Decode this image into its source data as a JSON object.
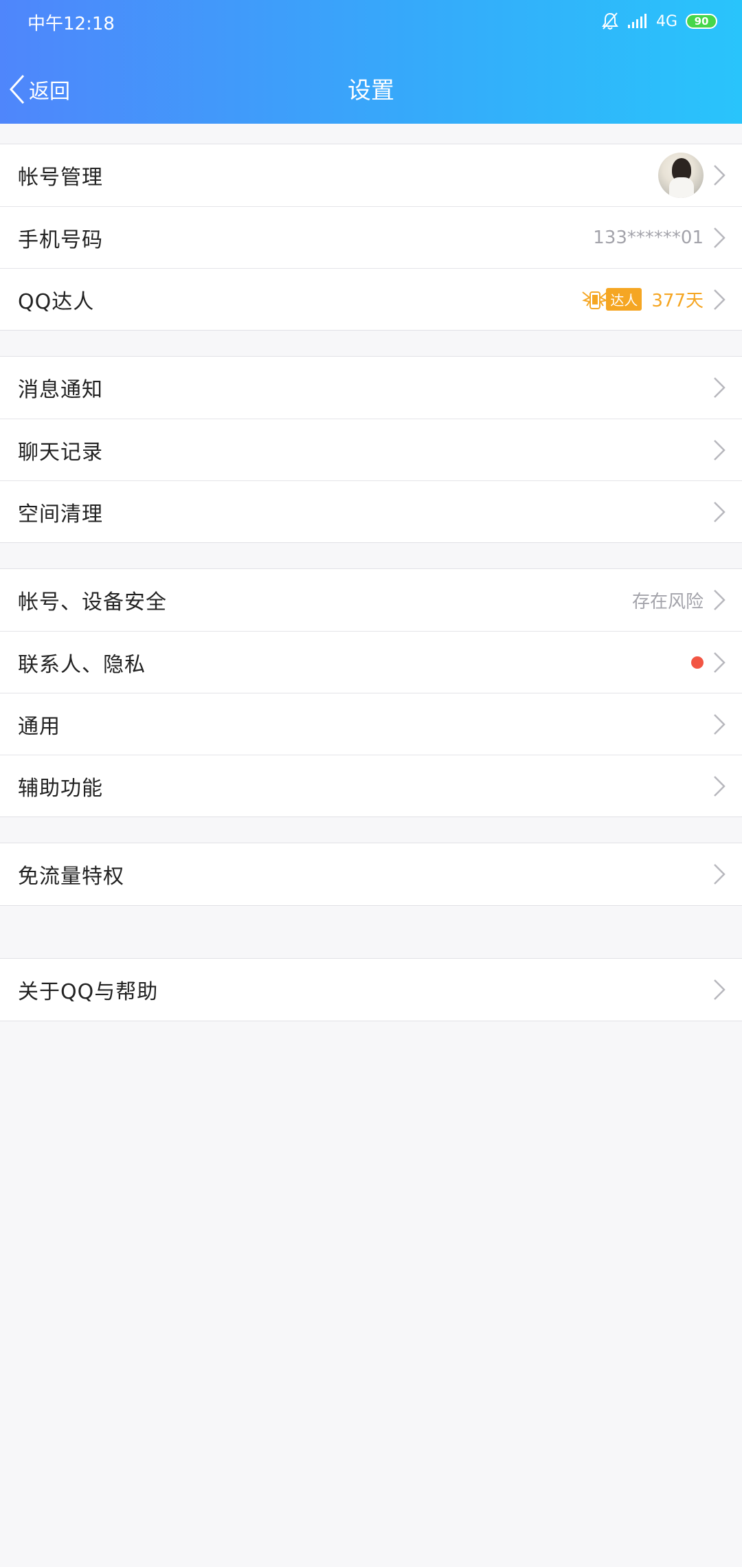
{
  "status_bar": {
    "time": "中午12:18",
    "network": "4G",
    "battery": "90"
  },
  "nav": {
    "back_label": "返回",
    "title": "设置"
  },
  "groups": [
    {
      "items": [
        {
          "label": "帐号管理",
          "value": ""
        },
        {
          "label": "手机号码",
          "value": "133******01"
        },
        {
          "label": "QQ达人",
          "badge": "达人",
          "value": "377天"
        }
      ]
    },
    {
      "items": [
        {
          "label": "消息通知"
        },
        {
          "label": "聊天记录"
        },
        {
          "label": "空间清理"
        }
      ]
    },
    {
      "items": [
        {
          "label": "帐号、设备安全",
          "value": "存在风险"
        },
        {
          "label": "联系人、隐私"
        },
        {
          "label": "通用"
        },
        {
          "label": "辅助功能"
        }
      ]
    },
    {
      "items": [
        {
          "label": "免流量特权"
        }
      ]
    },
    {
      "items": [
        {
          "label": "关于QQ与帮助"
        }
      ]
    }
  ],
  "colors": {
    "header_start": "#4f86fb",
    "header_end": "#29c4fb",
    "accent_orange": "#f5a623",
    "red_dot": "#f25543"
  }
}
